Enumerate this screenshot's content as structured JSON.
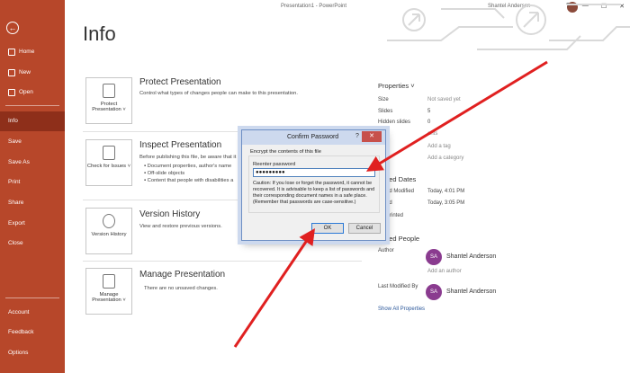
{
  "app": {
    "title": "Presentation1 - PowerPoint",
    "user": "Shantel Anderson",
    "window_controls": [
      "?",
      "—",
      "☐",
      "✕"
    ]
  },
  "sidebar": {
    "back_icon": "arrow-left-icon",
    "items": [
      {
        "label": "Home",
        "icon": "home-icon"
      },
      {
        "label": "New",
        "icon": "new-file-icon"
      },
      {
        "label": "Open",
        "icon": "folder-open-icon"
      },
      {
        "label": "Info",
        "active": true
      },
      {
        "label": "Save"
      },
      {
        "label": "Save As"
      },
      {
        "label": "Print"
      },
      {
        "label": "Share"
      },
      {
        "label": "Export"
      },
      {
        "label": "Close"
      }
    ],
    "bottom_items": [
      {
        "label": "Account"
      },
      {
        "label": "Feedback"
      },
      {
        "label": "Options"
      }
    ],
    "colors": {
      "bg": "#b7472a",
      "active": "#8e2f1a"
    }
  },
  "main": {
    "heading": "Info",
    "sections": [
      {
        "button_label": "Protect Presentation ˅",
        "button_icon": "lock-document-icon",
        "title": "Protect Presentation",
        "desc": "Control what types of changes people can make to this presentation."
      },
      {
        "button_label": "Check for Issues ˅",
        "button_icon": "inspect-document-icon",
        "title": "Inspect Presentation",
        "desc": "Before publishing this file, be aware that it",
        "bullets": [
          "Document properties, author's name",
          "Off-slide objects",
          "Content that people with disabilities a"
        ]
      },
      {
        "button_label": "Version History",
        "button_icon": "history-clock-icon",
        "title": "Version History",
        "desc": "View and restore previous versions."
      },
      {
        "button_label": "Manage Presentation ˅",
        "button_icon": "manage-document-icon",
        "title": "Manage Presentation",
        "desc": "There are no unsaved changes."
      }
    ]
  },
  "properties": {
    "title": "Properties ˅",
    "rows": [
      {
        "label": "Size",
        "value": "Not saved yet"
      },
      {
        "label": "Slides",
        "value": "5"
      },
      {
        "label": "Hidden slides",
        "value": "0"
      },
      {
        "label": "",
        "value": "ants"
      },
      {
        "label": "",
        "value": "Add a tag"
      },
      {
        "label": "",
        "value": "Add a category"
      }
    ],
    "dates_title": "ated Dates",
    "dates": [
      {
        "label": "ed Modified",
        "value": "Today, 4:01 PM"
      },
      {
        "label": "ed",
        "value": "Today, 3:05 PM"
      },
      {
        "label": "Printed",
        "value": ""
      }
    ],
    "people_title": "ated People",
    "author_label": "Author",
    "author_initials": "SA",
    "author_name": "Shantel Anderson",
    "add_author": "Add an author",
    "last_modified_label": "Last Modified By",
    "last_modified_initials": "SA",
    "last_modified_name": "Shantel Anderson",
    "show_all": "Show All Properties"
  },
  "dialog": {
    "title": "Confirm Password",
    "help": "?",
    "close": "✕",
    "group_label": "Encrypt the contents of this file",
    "field_label": "Reenter password",
    "field_value": "●●●●●●●●●",
    "caution": "Caution: If you lose or forget the password, it cannot be recovered. It is advisable to keep a list of passwords and their corresponding document names in a safe place. (Remember that passwords are case-sensitive.)",
    "ok_label": "OK",
    "cancel_label": "Cancel"
  }
}
